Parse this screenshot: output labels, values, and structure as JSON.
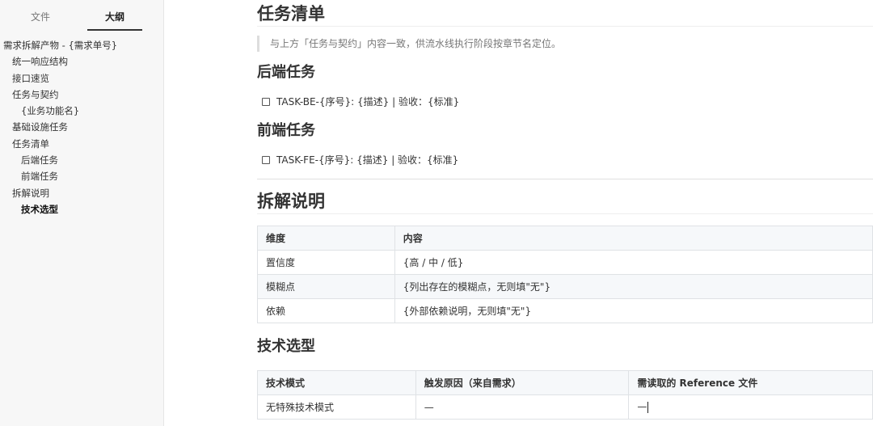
{
  "sidebar": {
    "tabs": [
      {
        "label": "文件"
      },
      {
        "label": "大纲"
      }
    ],
    "outline": [
      {
        "label": "需求拆解产物 - {需求单号}"
      },
      {
        "label": "统一响应结构"
      },
      {
        "label": "接口速览"
      },
      {
        "label": "任务与契约"
      },
      {
        "label": "{业务功能名}"
      },
      {
        "label": "基础设施任务"
      },
      {
        "label": "任务清单"
      },
      {
        "label": "后端任务"
      },
      {
        "label": "前端任务"
      },
      {
        "label": "拆解说明"
      },
      {
        "label": "技术选型"
      }
    ]
  },
  "content": {
    "task_list_heading": "任务清单",
    "quote": "与上方「任务与契约」内容一致，供流水线执行阶段按章节名定位。",
    "backend_heading": "后端任务",
    "backend_task": "TASK-BE-{序号}: {描述} | 验收：{标准}",
    "frontend_heading": "前端任务",
    "frontend_task": "TASK-FE-{序号}: {描述} | 验收：{标准}",
    "breakdown_heading": "拆解说明",
    "breakdown_table": {
      "headers": [
        "维度",
        "内容"
      ],
      "rows": [
        [
          "置信度",
          "{高 / 中 / 低}"
        ],
        [
          "模糊点",
          "{列出存在的模糊点，无则填\"无\"}"
        ],
        [
          "依赖",
          "{外部依赖说明，无则填\"无\"}"
        ]
      ]
    },
    "tech_heading": "技术选型",
    "tech_table": {
      "headers": [
        "技术模式",
        "触发原因（来自需求）",
        "需读取的 Reference 文件"
      ],
      "rows": [
        [
          "无特殊技术模式",
          "—",
          "—"
        ]
      ]
    }
  }
}
